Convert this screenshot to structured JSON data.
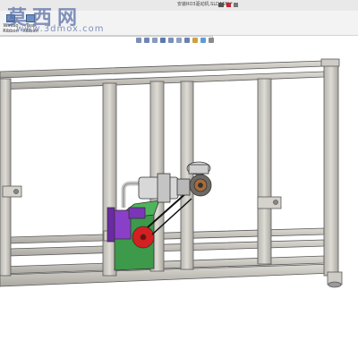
{
  "window": {
    "title": "安装RO3驱动机.SLDASM *"
  },
  "watermark": {
    "chinese": "莫西网",
    "url": "www.3dmox.com"
  },
  "toolbar": {
    "buttons": [
      {
        "label": "Wireso Ribbon",
        "icon": "wire-icon"
      },
      {
        "label": "Test Ribbon",
        "icon": "test-icon"
      }
    ]
  },
  "heads_up_view": {
    "icons": [
      "zoom-fit-icon",
      "zoom-area-icon",
      "previous-view-icon",
      "section-view-icon",
      "view-orientation-icon",
      "display-style-icon",
      "hide-show-icon",
      "appearance-icon",
      "scene-icon",
      "view-settings-icon"
    ]
  },
  "title_icons": [
    "camera-icon",
    "pin-icon",
    "help-icon"
  ],
  "colors": {
    "frame": "#c9c6c0",
    "frame_edge": "#5a5a5a",
    "motor": "#8a3fc9",
    "wheel": "#d42020",
    "base": "#3d9a4a",
    "silver": "#d8d8d8"
  }
}
